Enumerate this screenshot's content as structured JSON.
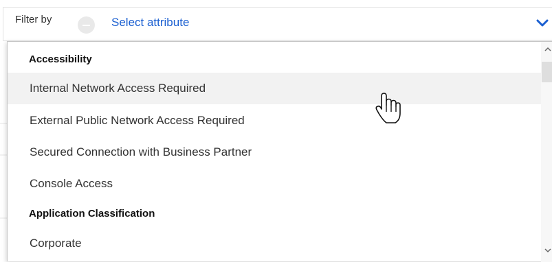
{
  "filter": {
    "label": "Filter by",
    "select_placeholder": "Select attribute",
    "remove_icon": "minus-circle-icon",
    "toggle_icon": "chevron-down-icon",
    "accent_color": "#1a5fd1"
  },
  "dropdown": {
    "groups": [
      {
        "header": "Accessibility",
        "options": [
          "Internal Network Access Required",
          "External Public Network Access Required",
          "Secured Connection with Business Partner",
          "Console Access"
        ]
      },
      {
        "header": "Application Classification",
        "options": [
          "Corporate"
        ]
      }
    ],
    "hovered_option": "Internal Network Access Required"
  },
  "cursor": {
    "icon": "hand-pointer-icon"
  }
}
